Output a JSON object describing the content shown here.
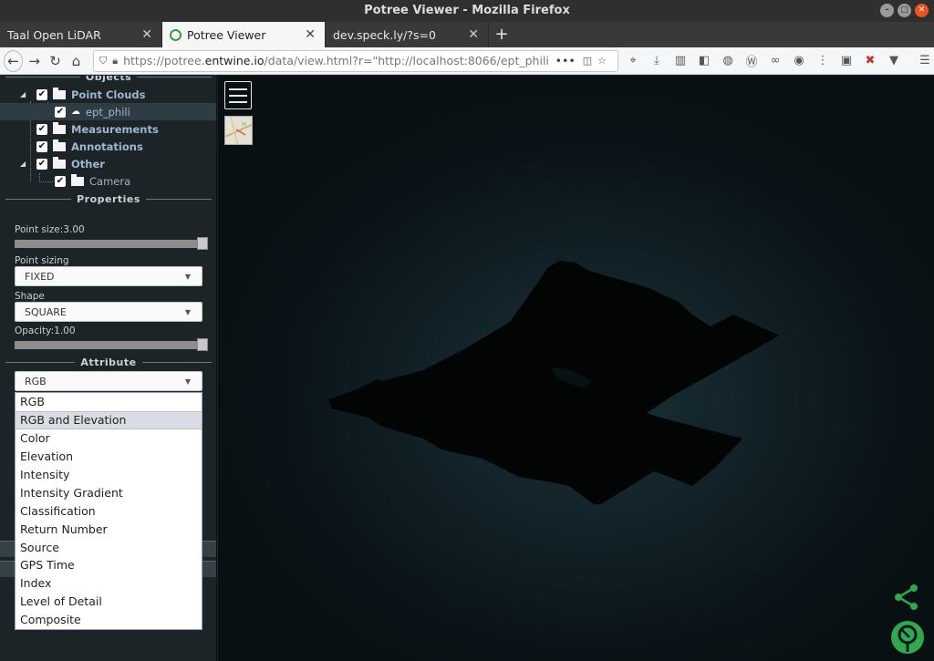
{
  "window": {
    "title": "Potree Viewer - Mozilla Firefox"
  },
  "tabs": [
    {
      "label": "Taal Open LiDAR",
      "active": false
    },
    {
      "label": "Potree Viewer",
      "active": true
    },
    {
      "label": "dev.speck.ly/?s=0",
      "active": false
    }
  ],
  "navbar": {
    "url_prefix": "https://potree.",
    "url_domain": "entwine.io",
    "url_rest": "/data/view.html?r=\"http://localhost:8066/ept_phili\"",
    "overflow": "•••"
  },
  "sidebar": {
    "objects_title": "Objects",
    "tree": {
      "point_clouds": "Point Clouds",
      "ept_phili": "ept_phili",
      "measurements": "Measurements",
      "annotations": "Annotations",
      "other": "Other",
      "camera": "Camera"
    },
    "properties_title": "Properties",
    "point_size_label": "Point size:3.00",
    "point_size_value": 1.0,
    "point_sizing_label": "Point sizing",
    "point_sizing_value": "FIXED",
    "shape_label": "Shape",
    "shape_value": "SQUARE",
    "opacity_label": "Opacity:1.00",
    "opacity_value": 1.0,
    "attribute_title": "Attribute",
    "attribute_value": "RGB",
    "attribute_options": [
      "RGB",
      "RGB and Elevation",
      "Color",
      "Elevation",
      "Intensity",
      "Intensity Gradient",
      "Classification",
      "Return Number",
      "Source",
      "GPS Time",
      "Index",
      "Level of Detail",
      "Composite"
    ],
    "hovered_option": "RGB and Elevation"
  },
  "colors": {
    "sidebar_bg": "#1c2428",
    "tree_text": "#9fb6cf",
    "accent_green": "#2fa84f",
    "viewport_glow": "#1a3138"
  }
}
